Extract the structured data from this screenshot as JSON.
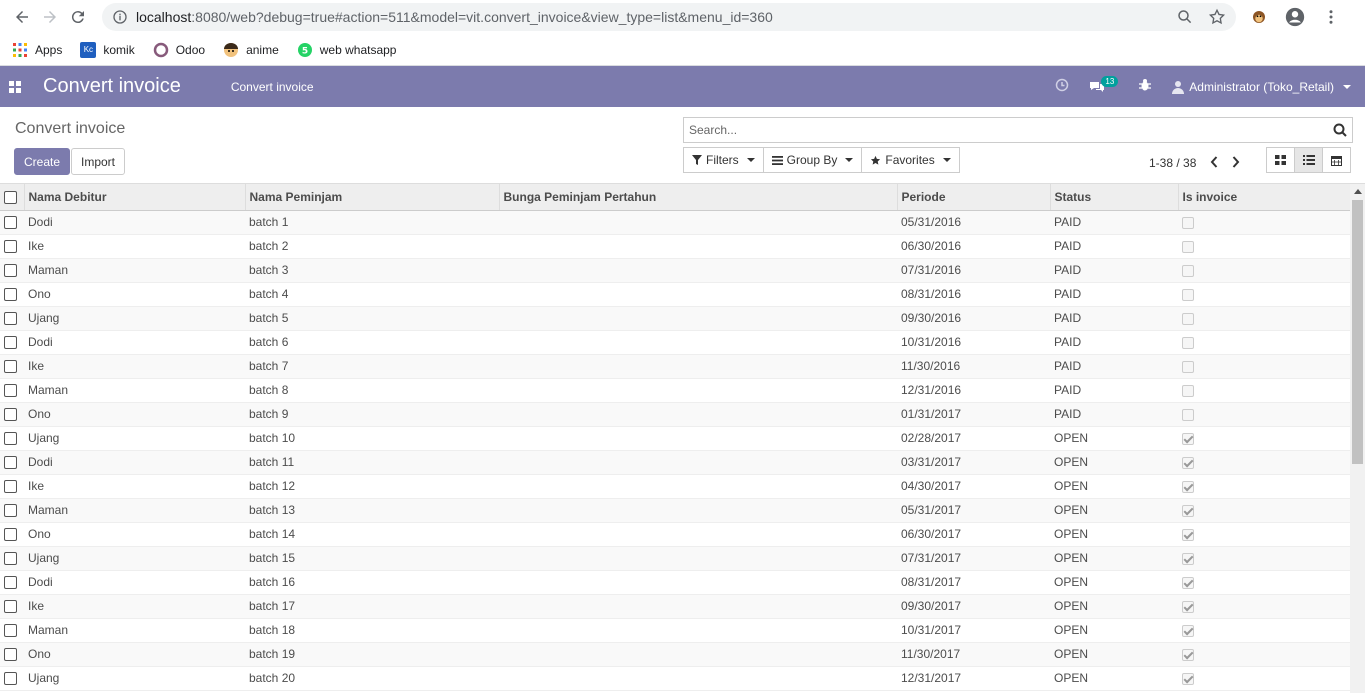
{
  "browser": {
    "url_host": "localhost",
    "url_rest": ":8080/web?debug=true#action=511&model=vit.convert_invoice&view_type=list&menu_id=360"
  },
  "bookmarks": [
    {
      "label": "Apps",
      "icon": "apps-grid-icon"
    },
    {
      "label": "komik",
      "icon": "kc-icon"
    },
    {
      "label": "Odoo",
      "icon": "odoo-icon"
    },
    {
      "label": "anime",
      "icon": "anime-icon"
    },
    {
      "label": "web whatsapp",
      "icon": "whatsapp-icon"
    }
  ],
  "topbar": {
    "app_title": "Convert invoice",
    "menu_item": "Convert invoice",
    "messages_count": "13",
    "user": "Administrator (Toko_Retail)"
  },
  "control_panel": {
    "breadcrumb": "Convert invoice",
    "create_label": "Create",
    "import_label": "Import",
    "search_placeholder": "Search...",
    "filters_label": "Filters",
    "groupby_label": "Group By",
    "favorites_label": "Favorites",
    "pager": "1-38 / 38"
  },
  "table": {
    "headers": [
      "Nama Debitur",
      "Nama Peminjam",
      "Bunga Peminjam Pertahun",
      "Periode",
      "Status",
      "Is invoice"
    ],
    "rows": [
      {
        "debitur": "Dodi",
        "peminjam": "batch 1",
        "bunga": "",
        "periode": "05/31/2016",
        "status": "PAID",
        "is_invoice": false
      },
      {
        "debitur": "Ike",
        "peminjam": "batch 2",
        "bunga": "",
        "periode": "06/30/2016",
        "status": "PAID",
        "is_invoice": false
      },
      {
        "debitur": "Maman",
        "peminjam": "batch 3",
        "bunga": "",
        "periode": "07/31/2016",
        "status": "PAID",
        "is_invoice": false
      },
      {
        "debitur": "Ono",
        "peminjam": "batch 4",
        "bunga": "",
        "periode": "08/31/2016",
        "status": "PAID",
        "is_invoice": false
      },
      {
        "debitur": "Ujang",
        "peminjam": "batch 5",
        "bunga": "",
        "periode": "09/30/2016",
        "status": "PAID",
        "is_invoice": false
      },
      {
        "debitur": "Dodi",
        "peminjam": "batch 6",
        "bunga": "",
        "periode": "10/31/2016",
        "status": "PAID",
        "is_invoice": false
      },
      {
        "debitur": "Ike",
        "peminjam": "batch 7",
        "bunga": "",
        "periode": "11/30/2016",
        "status": "PAID",
        "is_invoice": false
      },
      {
        "debitur": "Maman",
        "peminjam": "batch 8",
        "bunga": "",
        "periode": "12/31/2016",
        "status": "PAID",
        "is_invoice": false
      },
      {
        "debitur": "Ono",
        "peminjam": "batch 9",
        "bunga": "",
        "periode": "01/31/2017",
        "status": "PAID",
        "is_invoice": false
      },
      {
        "debitur": "Ujang",
        "peminjam": "batch 10",
        "bunga": "",
        "periode": "02/28/2017",
        "status": "OPEN",
        "is_invoice": true
      },
      {
        "debitur": "Dodi",
        "peminjam": "batch 11",
        "bunga": "",
        "periode": "03/31/2017",
        "status": "OPEN",
        "is_invoice": true
      },
      {
        "debitur": "Ike",
        "peminjam": "batch 12",
        "bunga": "",
        "periode": "04/30/2017",
        "status": "OPEN",
        "is_invoice": true
      },
      {
        "debitur": "Maman",
        "peminjam": "batch 13",
        "bunga": "",
        "periode": "05/31/2017",
        "status": "OPEN",
        "is_invoice": true
      },
      {
        "debitur": "Ono",
        "peminjam": "batch 14",
        "bunga": "",
        "periode": "06/30/2017",
        "status": "OPEN",
        "is_invoice": true
      },
      {
        "debitur": "Ujang",
        "peminjam": "batch 15",
        "bunga": "",
        "periode": "07/31/2017",
        "status": "OPEN",
        "is_invoice": true
      },
      {
        "debitur": "Dodi",
        "peminjam": "batch 16",
        "bunga": "",
        "periode": "08/31/2017",
        "status": "OPEN",
        "is_invoice": true
      },
      {
        "debitur": "Ike",
        "peminjam": "batch 17",
        "bunga": "",
        "periode": "09/30/2017",
        "status": "OPEN",
        "is_invoice": true
      },
      {
        "debitur": "Maman",
        "peminjam": "batch 18",
        "bunga": "",
        "periode": "10/31/2017",
        "status": "OPEN",
        "is_invoice": true
      },
      {
        "debitur": "Ono",
        "peminjam": "batch 19",
        "bunga": "",
        "periode": "11/30/2017",
        "status": "OPEN",
        "is_invoice": true
      },
      {
        "debitur": "Ujang",
        "peminjam": "batch 20",
        "bunga": "",
        "periode": "12/31/2017",
        "status": "OPEN",
        "is_invoice": true
      }
    ]
  }
}
